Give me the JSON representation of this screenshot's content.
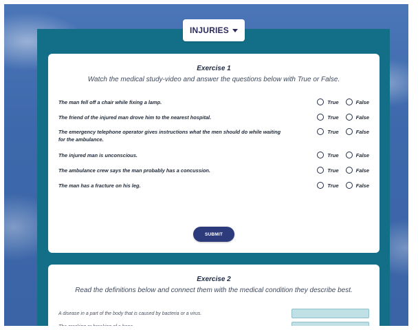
{
  "nav": {
    "tab_label": "INJURIES"
  },
  "exercise1": {
    "title": "Exercise 1",
    "instructions": "Watch the medical study-video and answer the questions below with True or False.",
    "questions": [
      {
        "text": "The man fell off a chair while fixing a lamp."
      },
      {
        "text": "The friend of the injured man drove him to the nearest hospital."
      },
      {
        "text": "The emergency telephone operator gives instructions what the men should do while waiting for the ambulance."
      },
      {
        "text": "The injured man is unconscious."
      },
      {
        "text": "The ambulance crew says the man probably has a concussion."
      },
      {
        "text": "The man has a fracture on his leg."
      }
    ],
    "true_label": "True",
    "false_label": "False",
    "submit_label": "SUBMIT"
  },
  "exercise2": {
    "title": "Exercise 2",
    "instructions": "Read the definitions below and connect them with the medical condition they describe best.",
    "definitions": [
      {
        "text": "A disease in a part of the body that is caused by bacteria or a virus."
      },
      {
        "text": "The cracking or breaking of a bone."
      }
    ]
  }
}
